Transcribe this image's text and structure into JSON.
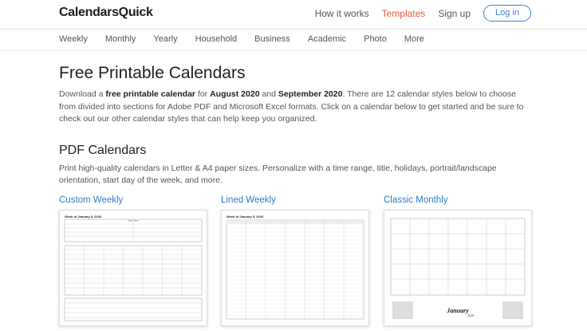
{
  "header": {
    "logo": "CalendarsQuick",
    "links": [
      "How it works",
      "Templates",
      "Sign up"
    ],
    "login_label": "Log in"
  },
  "subnav": {
    "items": [
      "Weekly",
      "Monthly",
      "Yearly",
      "Household",
      "Business",
      "Academic",
      "Photo",
      "More"
    ]
  },
  "main": {
    "title": "Free Printable Calendars",
    "intro_1": "Download a ",
    "intro_b1": "free printable calendar",
    "intro_2": " for ",
    "intro_b2": "August 2020",
    "intro_3": " and ",
    "intro_b3": "September 2020",
    "intro_4": ". There are 12 calendar styles below to choose from divided into sections for Adobe PDF and Microsoft Excel formats. Click on a calendar below to get started and be sure to check out our other calendar styles that can help keep you organized.",
    "pdf_title": "PDF Calendars",
    "pdf_desc": "Print high-quality calendars in Letter & A4 paper sizes. Personalize with a time range, title, holidays, portrait/landscape orientation, start day of the week, and more."
  },
  "cards": [
    {
      "title": "Custom Weekly",
      "thumb_heading": "Week of January 5, 2020",
      "thumb_sub": "Action Items"
    },
    {
      "title": "Lined Weekly",
      "thumb_heading": "Week of January 5, 2020"
    },
    {
      "title": "Classic Monthly",
      "thumb_month": "January",
      "thumb_year": "2020"
    }
  ],
  "colors": {
    "accent": "#e55d3b",
    "link": "#2c7cc6",
    "button": "#3b82d6"
  }
}
